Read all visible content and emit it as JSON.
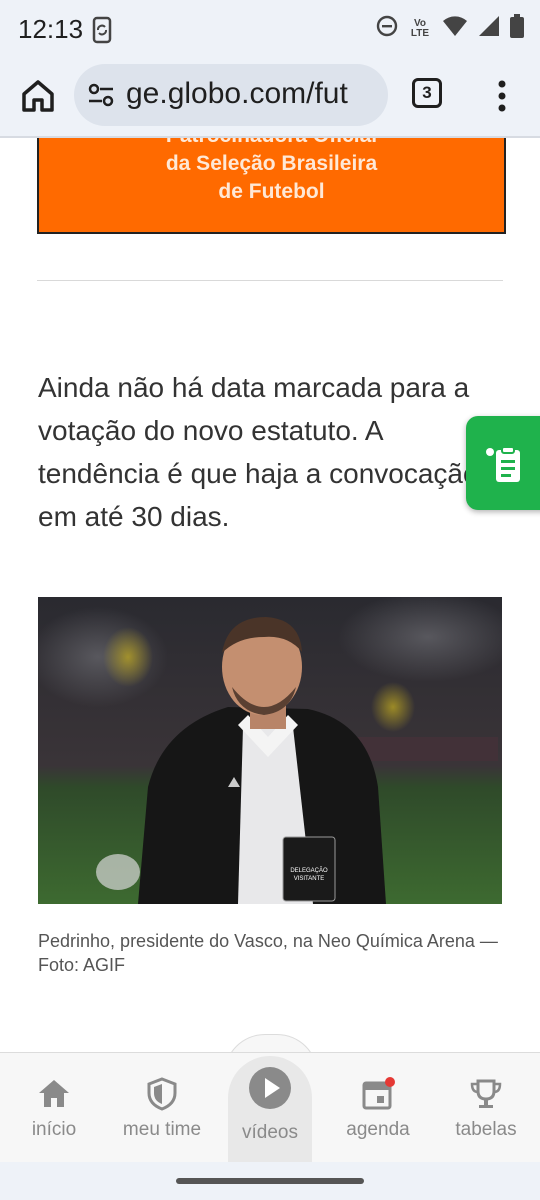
{
  "status_bar": {
    "time": "12:13",
    "left_icon": "phone-sync-icon",
    "right_icons": [
      "do-not-disturb-icon",
      "volte-icon",
      "wifi-icon",
      "cellular-signal-icon",
      "battery-icon"
    ],
    "volte_label_top": "Vo",
    "volte_label_bottom": "LTE"
  },
  "browser": {
    "url": "ge.globo.com/fut",
    "tab_count": "3",
    "home_icon": "home-icon",
    "site_settings_icon": "tune-icon",
    "menu_icon": "more-vert-icon"
  },
  "ad": {
    "line0": "Patrocinadora Oficial",
    "line1": "da Seleção Brasileira",
    "line2": "de Futebol",
    "color": "#ff6a00"
  },
  "article": {
    "paragraph_lines": [
      "Ainda não há data marcada para a",
      "votação do novo estatuto. A",
      "tendência é que haja a convocação",
      "em até 30 dias."
    ],
    "photo_icon": "photo-of-man-in-black-jacket",
    "photo_caption": "Pedrinho, presidente do Vasco, na Neo Química Arena — Foto: AGIF",
    "badge_text_1": "DELEGAÇÃO",
    "badge_text_2": "VISITANTE"
  },
  "floating_button": {
    "icon": "clipboard-list-icon",
    "color": "#1fb24c"
  },
  "bottom_nav": {
    "items": [
      {
        "label": "início",
        "icon": "home-icon"
      },
      {
        "label": "meu time",
        "icon": "shield-icon"
      },
      {
        "label": "vídeos",
        "icon": "play-circle-icon"
      },
      {
        "label": "agenda",
        "icon": "calendar-icon"
      },
      {
        "label": "tabelas",
        "icon": "trophy-icon"
      }
    ],
    "active_index": 2,
    "notification_color": "#e53935"
  }
}
